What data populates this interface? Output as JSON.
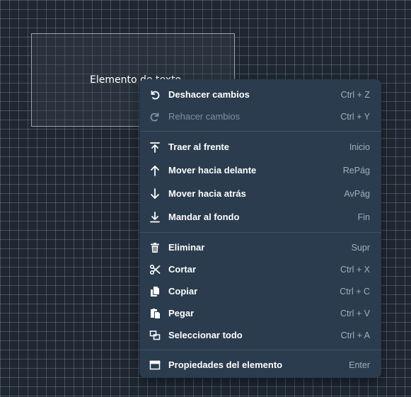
{
  "canvas": {
    "text_element_label": "Elemento de texto"
  },
  "menu": {
    "groups": [
      [
        {
          "icon": "undo-icon",
          "label": "Deshacer cambios",
          "shortcut": "Ctrl + Z",
          "disabled": false
        },
        {
          "icon": "redo-icon",
          "label": "Rehacer cambios",
          "shortcut": "Ctrl + Y",
          "disabled": true
        }
      ],
      [
        {
          "icon": "bring-to-front-icon",
          "label": "Traer al frente",
          "shortcut": "Inicio",
          "disabled": false
        },
        {
          "icon": "arrow-up-icon",
          "label": "Mover hacia delante",
          "shortcut": "RePág",
          "disabled": false
        },
        {
          "icon": "arrow-down-icon",
          "label": "Mover hacia atrás",
          "shortcut": "AvPág",
          "disabled": false
        },
        {
          "icon": "send-to-back-icon",
          "label": "Mandar al fondo",
          "shortcut": "Fin",
          "disabled": false
        }
      ],
      [
        {
          "icon": "trash-icon",
          "label": "Eliminar",
          "shortcut": "Supr",
          "disabled": false
        },
        {
          "icon": "scissors-icon",
          "label": "Cortar",
          "shortcut": "Ctrl + X",
          "disabled": false
        },
        {
          "icon": "copy-icon",
          "label": "Copiar",
          "shortcut": "Ctrl + C",
          "disabled": false
        },
        {
          "icon": "paste-icon",
          "label": "Pegar",
          "shortcut": "Ctrl + V",
          "disabled": false
        },
        {
          "icon": "select-all-icon",
          "label": "Seleccionar todo",
          "shortcut": "Ctrl + A",
          "disabled": false
        }
      ],
      [
        {
          "icon": "window-properties-icon",
          "label": "Propiedades del elemento",
          "shortcut": "Enter",
          "disabled": false
        }
      ]
    ]
  }
}
